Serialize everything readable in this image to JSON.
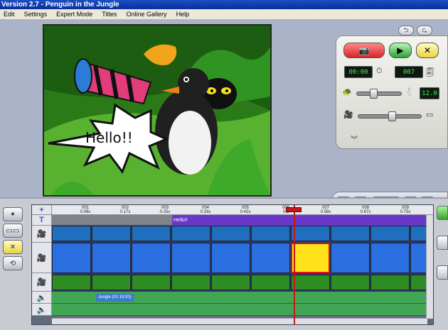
{
  "window": {
    "title": "Version 2.7 - Penguin in the Jungle"
  },
  "menu": [
    "Edit",
    "Settings",
    "Expert Mode",
    "Titles",
    "Online Gallery",
    "Help"
  ],
  "preview": {
    "speech_text": "Hello!!"
  },
  "controls": {
    "record_icon": "camera-icon",
    "play_icon": "play-icon",
    "delete_icon": "delete-frame-icon",
    "time": "00:00",
    "frame_count": "007",
    "speed_value": "12.0",
    "speed_slider_fraction": 0.35,
    "onion_slider_fraction": 0.55
  },
  "timeline": {
    "ticks": [
      {
        "frame": "001",
        "time": "0.08s"
      },
      {
        "frame": "002",
        "time": "0.17s"
      },
      {
        "frame": "003",
        "time": "0.25s"
      },
      {
        "frame": "004",
        "time": "0.33s"
      },
      {
        "frame": "005",
        "time": "0.42s"
      },
      {
        "frame": "006",
        "time": "0.5"
      },
      {
        "frame": "007",
        "time": "0.58s"
      },
      {
        "frame": "008",
        "time": "0.67s"
      },
      {
        "frame": "009",
        "time": "0.75s"
      }
    ],
    "title_clip": "Hello!!",
    "audio_clip": "Jungle (01:19:00)",
    "selected_frame": 7
  },
  "colors": {
    "titlebar": "#0a2f98",
    "record_button": "#e63a3a",
    "play_button": "#3bb34a",
    "playhead": "#c51717",
    "title_clip": "#6a36c8",
    "audio_track": "#40a654"
  }
}
